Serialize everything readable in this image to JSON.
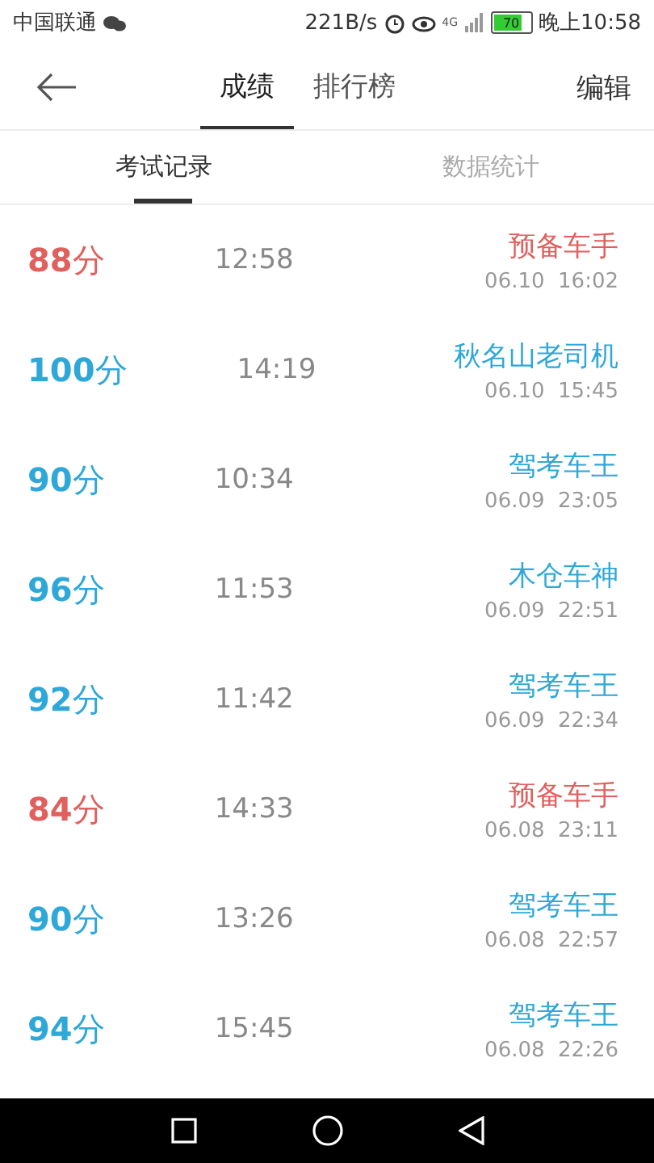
{
  "status_bar": {
    "carrier": "中国联通",
    "speed": "221B/s",
    "network": "4G",
    "battery": "70",
    "time": "晚上10:58"
  },
  "header": {
    "tabs": [
      {
        "label": "成绩",
        "selected": true
      },
      {
        "label": "排行榜",
        "selected": false
      }
    ],
    "action": "编辑"
  },
  "sub_tabs": [
    {
      "label": "考试记录",
      "selected": true
    },
    {
      "label": "数据统计",
      "selected": false
    }
  ],
  "records": [
    {
      "score": "88",
      "unit": "分",
      "duration": "12:58",
      "title": "预备车手",
      "date": "06.10  16:02",
      "color": "#e0605e"
    },
    {
      "score": "100",
      "unit": "分",
      "duration": "14:19",
      "title": "秋名山老司机",
      "date": "06.10  15:45",
      "color": "#2ea8d8"
    },
    {
      "score": "90",
      "unit": "分",
      "duration": "10:34",
      "title": "驾考车王",
      "date": "06.09  23:05",
      "color": "#2ea8d8"
    },
    {
      "score": "96",
      "unit": "分",
      "duration": "11:53",
      "title": "木仓车神",
      "date": "06.09  22:51",
      "color": "#2ea8d8"
    },
    {
      "score": "92",
      "unit": "分",
      "duration": "11:42",
      "title": "驾考车王",
      "date": "06.09  22:34",
      "color": "#2ea8d8"
    },
    {
      "score": "84",
      "unit": "分",
      "duration": "14:33",
      "title": "预备车手",
      "date": "06.08  23:11",
      "color": "#e0605e"
    },
    {
      "score": "90",
      "unit": "分",
      "duration": "13:26",
      "title": "驾考车王",
      "date": "06.08  22:57",
      "color": "#2ea8d8"
    },
    {
      "score": "94",
      "unit": "分",
      "duration": "15:45",
      "title": "驾考车王",
      "date": "06.08  22:26",
      "color": "#2ea8d8"
    }
  ]
}
